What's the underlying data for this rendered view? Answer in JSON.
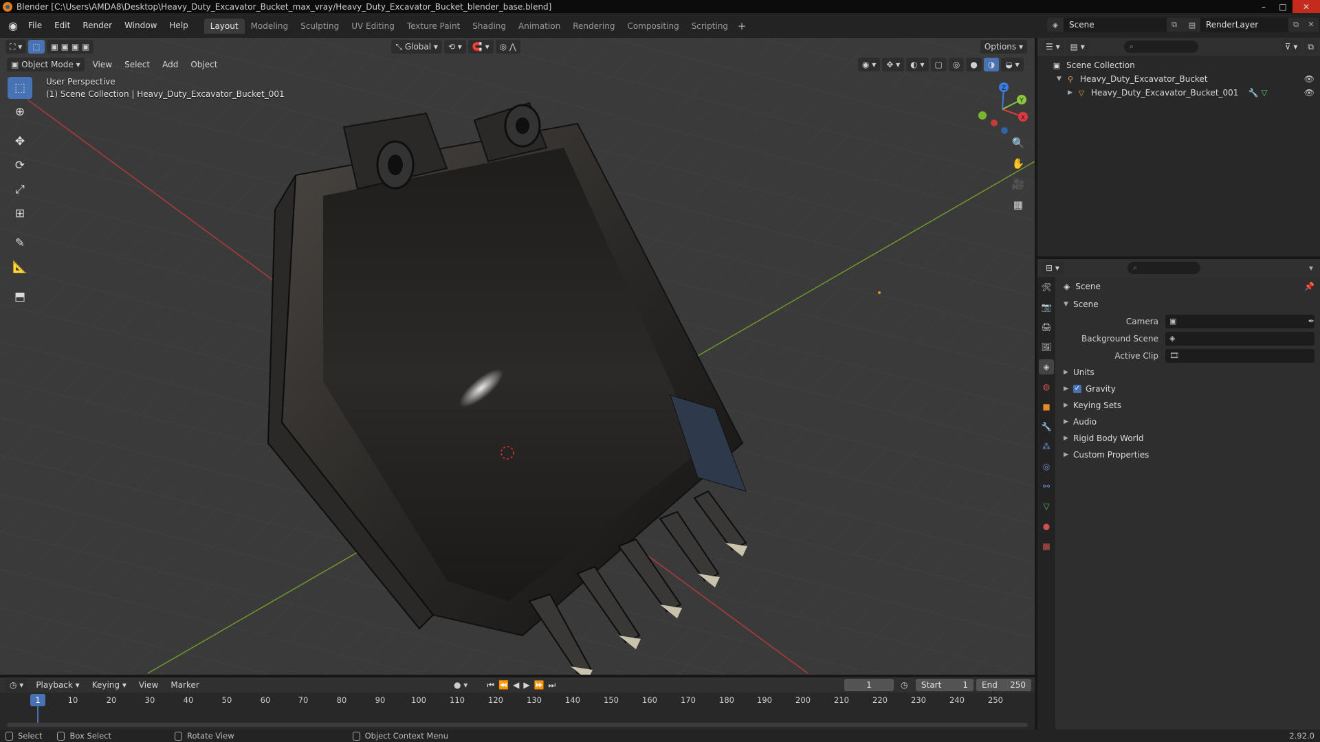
{
  "window": {
    "title": "Blender [C:\\Users\\AMDA8\\Desktop\\Heavy_Duty_Excavator_Bucket_max_vray/Heavy_Duty_Excavator_Bucket_blender_base.blend]",
    "controls": [
      "–",
      "□",
      "✕"
    ]
  },
  "menu": {
    "items": [
      "File",
      "Edit",
      "Render",
      "Window",
      "Help"
    ]
  },
  "workspaces": {
    "tabs": [
      "Layout",
      "Modeling",
      "Sculpting",
      "UV Editing",
      "Texture Paint",
      "Shading",
      "Animation",
      "Rendering",
      "Compositing",
      "Scripting"
    ],
    "active": "Layout"
  },
  "scene_selector": {
    "value": "Scene"
  },
  "render_layer": {
    "value": "RenderLayer"
  },
  "viewport": {
    "transform_orientation": "Global",
    "options_label": "Options",
    "mode": "Object Mode",
    "header_menus": [
      "View",
      "Select",
      "Add",
      "Object"
    ],
    "info_line1": "User Perspective",
    "info_line2": "(1) Scene Collection | Heavy_Duty_Excavator_Bucket_001",
    "gizmo": {
      "x": "X",
      "y": "Y",
      "z": "Z"
    },
    "colors": {
      "background": "#3a3a3a",
      "x_axis": "#b33a3a",
      "y_axis": "#6f9a2a",
      "active": "#4772b3"
    }
  },
  "toolbar": {
    "tools": [
      "select-box",
      "cursor",
      "move",
      "rotate",
      "scale",
      "transform",
      "annotate",
      "measure",
      "add-cube"
    ]
  },
  "outliner": {
    "root": "Scene Collection",
    "items": [
      {
        "label": "Heavy_Duty_Excavator_Bucket",
        "type": "empty"
      },
      {
        "label": "Heavy_Duty_Excavator_Bucket_001",
        "type": "mesh"
      }
    ]
  },
  "properties": {
    "context": "Scene",
    "panel_title": "Scene",
    "fields": [
      {
        "label": "Camera",
        "value": ""
      },
      {
        "label": "Background Scene",
        "value": ""
      },
      {
        "label": "Active Clip",
        "value": ""
      }
    ],
    "subpanels": [
      "Units",
      "Gravity",
      "Keying Sets",
      "Audio",
      "Rigid Body World",
      "Custom Properties"
    ],
    "gravity_checked": true
  },
  "timeline": {
    "menus": [
      "Playback",
      "Keying",
      "View",
      "Marker"
    ],
    "current_frame": "1",
    "start_label": "Start",
    "start": "1",
    "end_label": "End",
    "end": "250",
    "ruler": [
      "10",
      "20",
      "30",
      "40",
      "50",
      "60",
      "70",
      "80",
      "90",
      "100",
      "110",
      "120",
      "130",
      "140",
      "150",
      "160",
      "170",
      "180",
      "190",
      "200",
      "210",
      "220",
      "230",
      "240",
      "250"
    ],
    "playhead": "1"
  },
  "statusbar": {
    "items": [
      "Select",
      "Box Select",
      "Rotate View",
      "Object Context Menu"
    ],
    "version": "2.92.0"
  }
}
